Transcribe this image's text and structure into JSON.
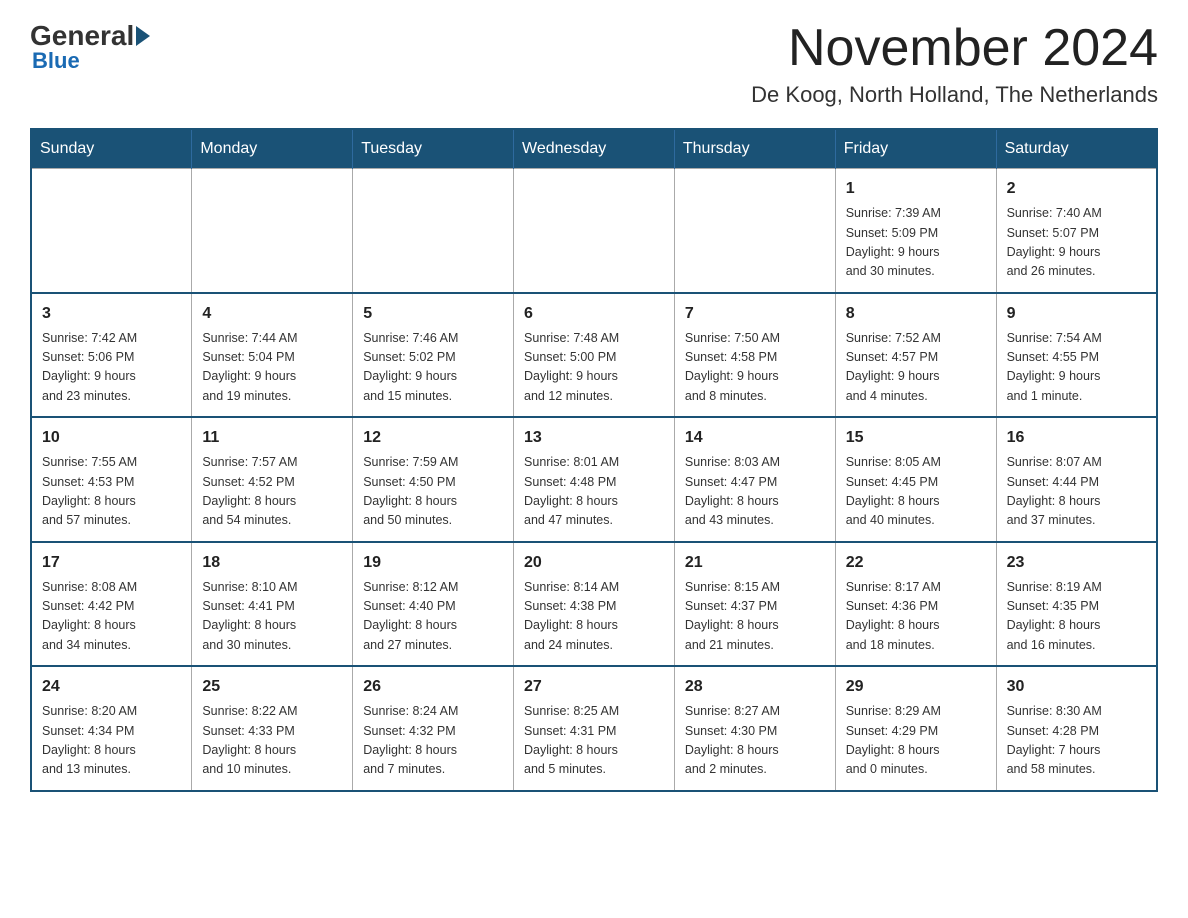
{
  "header": {
    "logo_general": "General",
    "logo_blue": "Blue",
    "month_year": "November 2024",
    "location": "De Koog, North Holland, The Netherlands"
  },
  "days_of_week": [
    "Sunday",
    "Monday",
    "Tuesday",
    "Wednesday",
    "Thursday",
    "Friday",
    "Saturday"
  ],
  "weeks": [
    [
      {
        "day": "",
        "info": ""
      },
      {
        "day": "",
        "info": ""
      },
      {
        "day": "",
        "info": ""
      },
      {
        "day": "",
        "info": ""
      },
      {
        "day": "",
        "info": ""
      },
      {
        "day": "1",
        "info": "Sunrise: 7:39 AM\nSunset: 5:09 PM\nDaylight: 9 hours\nand 30 minutes."
      },
      {
        "day": "2",
        "info": "Sunrise: 7:40 AM\nSunset: 5:07 PM\nDaylight: 9 hours\nand 26 minutes."
      }
    ],
    [
      {
        "day": "3",
        "info": "Sunrise: 7:42 AM\nSunset: 5:06 PM\nDaylight: 9 hours\nand 23 minutes."
      },
      {
        "day": "4",
        "info": "Sunrise: 7:44 AM\nSunset: 5:04 PM\nDaylight: 9 hours\nand 19 minutes."
      },
      {
        "day": "5",
        "info": "Sunrise: 7:46 AM\nSunset: 5:02 PM\nDaylight: 9 hours\nand 15 minutes."
      },
      {
        "day": "6",
        "info": "Sunrise: 7:48 AM\nSunset: 5:00 PM\nDaylight: 9 hours\nand 12 minutes."
      },
      {
        "day": "7",
        "info": "Sunrise: 7:50 AM\nSunset: 4:58 PM\nDaylight: 9 hours\nand 8 minutes."
      },
      {
        "day": "8",
        "info": "Sunrise: 7:52 AM\nSunset: 4:57 PM\nDaylight: 9 hours\nand 4 minutes."
      },
      {
        "day": "9",
        "info": "Sunrise: 7:54 AM\nSunset: 4:55 PM\nDaylight: 9 hours\nand 1 minute."
      }
    ],
    [
      {
        "day": "10",
        "info": "Sunrise: 7:55 AM\nSunset: 4:53 PM\nDaylight: 8 hours\nand 57 minutes."
      },
      {
        "day": "11",
        "info": "Sunrise: 7:57 AM\nSunset: 4:52 PM\nDaylight: 8 hours\nand 54 minutes."
      },
      {
        "day": "12",
        "info": "Sunrise: 7:59 AM\nSunset: 4:50 PM\nDaylight: 8 hours\nand 50 minutes."
      },
      {
        "day": "13",
        "info": "Sunrise: 8:01 AM\nSunset: 4:48 PM\nDaylight: 8 hours\nand 47 minutes."
      },
      {
        "day": "14",
        "info": "Sunrise: 8:03 AM\nSunset: 4:47 PM\nDaylight: 8 hours\nand 43 minutes."
      },
      {
        "day": "15",
        "info": "Sunrise: 8:05 AM\nSunset: 4:45 PM\nDaylight: 8 hours\nand 40 minutes."
      },
      {
        "day": "16",
        "info": "Sunrise: 8:07 AM\nSunset: 4:44 PM\nDaylight: 8 hours\nand 37 minutes."
      }
    ],
    [
      {
        "day": "17",
        "info": "Sunrise: 8:08 AM\nSunset: 4:42 PM\nDaylight: 8 hours\nand 34 minutes."
      },
      {
        "day": "18",
        "info": "Sunrise: 8:10 AM\nSunset: 4:41 PM\nDaylight: 8 hours\nand 30 minutes."
      },
      {
        "day": "19",
        "info": "Sunrise: 8:12 AM\nSunset: 4:40 PM\nDaylight: 8 hours\nand 27 minutes."
      },
      {
        "day": "20",
        "info": "Sunrise: 8:14 AM\nSunset: 4:38 PM\nDaylight: 8 hours\nand 24 minutes."
      },
      {
        "day": "21",
        "info": "Sunrise: 8:15 AM\nSunset: 4:37 PM\nDaylight: 8 hours\nand 21 minutes."
      },
      {
        "day": "22",
        "info": "Sunrise: 8:17 AM\nSunset: 4:36 PM\nDaylight: 8 hours\nand 18 minutes."
      },
      {
        "day": "23",
        "info": "Sunrise: 8:19 AM\nSunset: 4:35 PM\nDaylight: 8 hours\nand 16 minutes."
      }
    ],
    [
      {
        "day": "24",
        "info": "Sunrise: 8:20 AM\nSunset: 4:34 PM\nDaylight: 8 hours\nand 13 minutes."
      },
      {
        "day": "25",
        "info": "Sunrise: 8:22 AM\nSunset: 4:33 PM\nDaylight: 8 hours\nand 10 minutes."
      },
      {
        "day": "26",
        "info": "Sunrise: 8:24 AM\nSunset: 4:32 PM\nDaylight: 8 hours\nand 7 minutes."
      },
      {
        "day": "27",
        "info": "Sunrise: 8:25 AM\nSunset: 4:31 PM\nDaylight: 8 hours\nand 5 minutes."
      },
      {
        "day": "28",
        "info": "Sunrise: 8:27 AM\nSunset: 4:30 PM\nDaylight: 8 hours\nand 2 minutes."
      },
      {
        "day": "29",
        "info": "Sunrise: 8:29 AM\nSunset: 4:29 PM\nDaylight: 8 hours\nand 0 minutes."
      },
      {
        "day": "30",
        "info": "Sunrise: 8:30 AM\nSunset: 4:28 PM\nDaylight: 7 hours\nand 58 minutes."
      }
    ]
  ]
}
